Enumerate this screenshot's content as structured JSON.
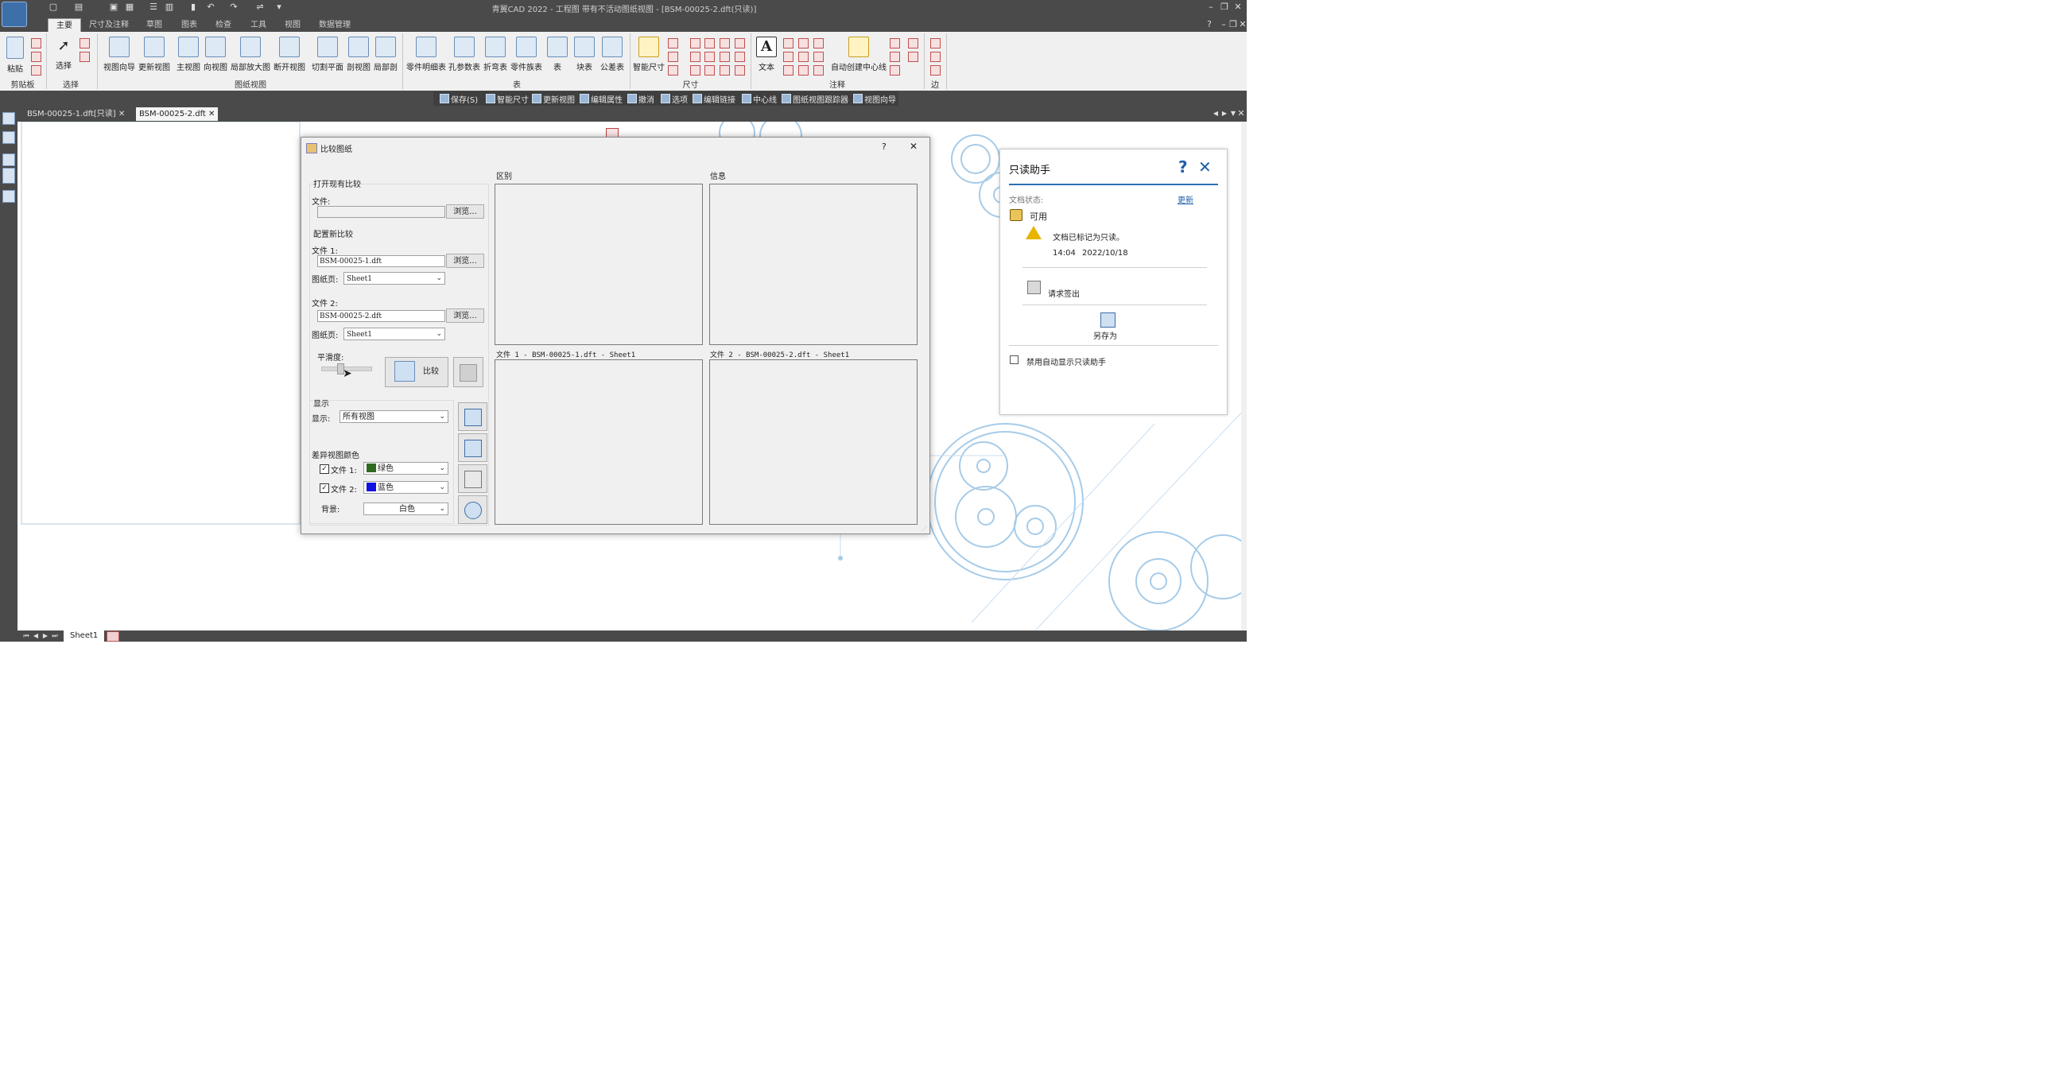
{
  "window": {
    "title": "青翼CAD 2022 - 工程图 带有不活动图纸视图 - [BSM-00025-2.dft(只读)]"
  },
  "ribbon_tabs": [
    "主要",
    "尺寸及注释",
    "草图",
    "图表",
    "检查",
    "工具",
    "视图",
    "数据管理"
  ],
  "ribbon": {
    "clipboard": {
      "paste": "粘贴",
      "group": "剪贴板"
    },
    "select": {
      "select": "选择",
      "group": "选择"
    },
    "drawing_views": {
      "items": [
        "视图向导",
        "更新视图",
        "主视图",
        "向视图",
        "局部放大图",
        "断开视图",
        "切割平面",
        "剖视图",
        "局部剖"
      ],
      "group": "图纸视图"
    },
    "tables": {
      "items": [
        "零件明细表",
        "孔参数表",
        "折弯表",
        "零件族表",
        "表",
        "块表",
        "公差表"
      ],
      "group": "表"
    },
    "dimension": {
      "items": [
        "智能尺寸"
      ],
      "group": "尺寸"
    },
    "annotation": {
      "items": [
        "文本",
        "自动创建中心线"
      ],
      "group": "注释"
    },
    "edge": {
      "group": "边"
    }
  },
  "command_bar": [
    "保存(S)",
    "智能尺寸",
    "更新视图",
    "编辑属性",
    "撤消",
    "选项",
    "编辑链接",
    "中心线",
    "图纸视图跟踪器",
    "视图向导"
  ],
  "doc_tabs": [
    {
      "label": "BSM-00025-1.dft[只读]",
      "active": false
    },
    {
      "label": "BSM-00025-2.dft",
      "active": true
    }
  ],
  "sheet_tab": "Sheet1",
  "dialog": {
    "title": "比较图纸",
    "help": "?",
    "close": "✕",
    "open_existing": {
      "heading": "打开现有比较",
      "file_label": "文件:",
      "file_value": "",
      "browse": "浏览..."
    },
    "new_compare": {
      "heading": "配置新比较",
      "file1_label": "文件 1:",
      "file1_value": "BSM-00025-1.dft",
      "browse1": "浏览...",
      "sheet1_label": "图纸页:",
      "sheet1_value": "Sheet1",
      "file2_label": "文件 2:",
      "file2_value": "BSM-00025-2.dft",
      "browse2": "浏览...",
      "sheet2_label": "图纸页:",
      "sheet2_value": "Sheet1"
    },
    "smoothness_label": "平滑度:",
    "compare_button": "比较",
    "display": {
      "heading": "显示",
      "show_label": "显示:",
      "show_value": "所有视图",
      "diff_color_heading": "差异视图颜色",
      "file1_label": "文件 1:",
      "file1_color_name": "绿色",
      "file1_color": "#2e6b1f",
      "file2_label": "文件 2:",
      "file2_color_name": "蓝色",
      "file2_color": "#1010e0",
      "bg_label": "背景:",
      "bg_value": "白色"
    },
    "diff_title": "区别",
    "info_title": "信息",
    "file1_panel_title": "文件 1 - BSM-00025-1.dft - Sheet1",
    "file2_panel_title": "文件 2 - BSM-00025-2.dft - Sheet1"
  },
  "readonly_helper": {
    "title": "只读助手",
    "doc_status_label": "文档状态:",
    "update_link": "更新",
    "status": "可用",
    "warning": "文档已标记为只读。",
    "time": "14:04",
    "date": "2022/10/18",
    "request_checkout": "请求签出",
    "save_as": "另存为",
    "disable_auto": "禁用自动显示只读助手"
  }
}
